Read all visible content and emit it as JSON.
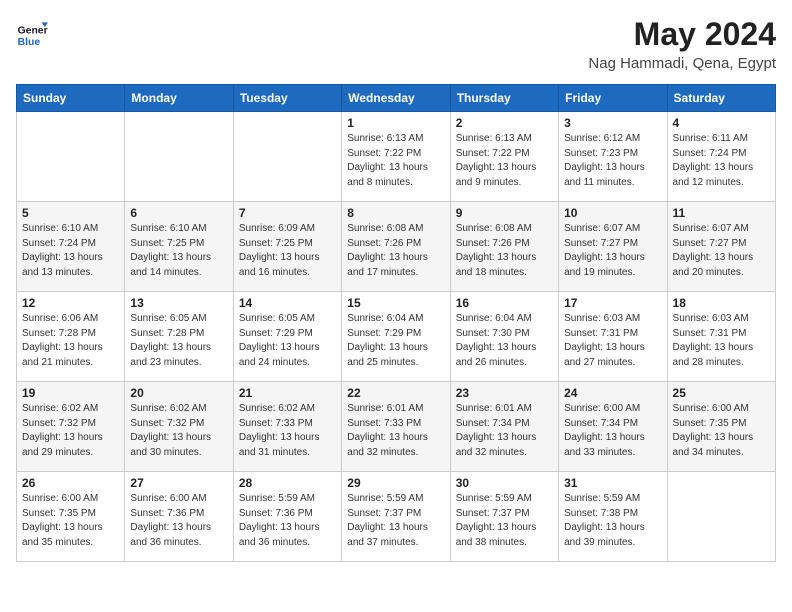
{
  "header": {
    "logo_line1": "General",
    "logo_line2": "Blue",
    "month_title": "May 2024",
    "location": "Nag Hammadi, Qena, Egypt"
  },
  "days_of_week": [
    "Sunday",
    "Monday",
    "Tuesday",
    "Wednesday",
    "Thursday",
    "Friday",
    "Saturday"
  ],
  "weeks": [
    [
      {
        "day": "",
        "sunrise": "",
        "sunset": "",
        "daylight": ""
      },
      {
        "day": "",
        "sunrise": "",
        "sunset": "",
        "daylight": ""
      },
      {
        "day": "",
        "sunrise": "",
        "sunset": "",
        "daylight": ""
      },
      {
        "day": "1",
        "sunrise": "6:13 AM",
        "sunset": "7:22 PM",
        "daylight": "13 hours and 8 minutes."
      },
      {
        "day": "2",
        "sunrise": "6:13 AM",
        "sunset": "7:22 PM",
        "daylight": "13 hours and 9 minutes."
      },
      {
        "day": "3",
        "sunrise": "6:12 AM",
        "sunset": "7:23 PM",
        "daylight": "13 hours and 11 minutes."
      },
      {
        "day": "4",
        "sunrise": "6:11 AM",
        "sunset": "7:24 PM",
        "daylight": "13 hours and 12 minutes."
      }
    ],
    [
      {
        "day": "5",
        "sunrise": "6:10 AM",
        "sunset": "7:24 PM",
        "daylight": "13 hours and 13 minutes."
      },
      {
        "day": "6",
        "sunrise": "6:10 AM",
        "sunset": "7:25 PM",
        "daylight": "13 hours and 14 minutes."
      },
      {
        "day": "7",
        "sunrise": "6:09 AM",
        "sunset": "7:25 PM",
        "daylight": "13 hours and 16 minutes."
      },
      {
        "day": "8",
        "sunrise": "6:08 AM",
        "sunset": "7:26 PM",
        "daylight": "13 hours and 17 minutes."
      },
      {
        "day": "9",
        "sunrise": "6:08 AM",
        "sunset": "7:26 PM",
        "daylight": "13 hours and 18 minutes."
      },
      {
        "day": "10",
        "sunrise": "6:07 AM",
        "sunset": "7:27 PM",
        "daylight": "13 hours and 19 minutes."
      },
      {
        "day": "11",
        "sunrise": "6:07 AM",
        "sunset": "7:27 PM",
        "daylight": "13 hours and 20 minutes."
      }
    ],
    [
      {
        "day": "12",
        "sunrise": "6:06 AM",
        "sunset": "7:28 PM",
        "daylight": "13 hours and 21 minutes."
      },
      {
        "day": "13",
        "sunrise": "6:05 AM",
        "sunset": "7:28 PM",
        "daylight": "13 hours and 23 minutes."
      },
      {
        "day": "14",
        "sunrise": "6:05 AM",
        "sunset": "7:29 PM",
        "daylight": "13 hours and 24 minutes."
      },
      {
        "day": "15",
        "sunrise": "6:04 AM",
        "sunset": "7:29 PM",
        "daylight": "13 hours and 25 minutes."
      },
      {
        "day": "16",
        "sunrise": "6:04 AM",
        "sunset": "7:30 PM",
        "daylight": "13 hours and 26 minutes."
      },
      {
        "day": "17",
        "sunrise": "6:03 AM",
        "sunset": "7:31 PM",
        "daylight": "13 hours and 27 minutes."
      },
      {
        "day": "18",
        "sunrise": "6:03 AM",
        "sunset": "7:31 PM",
        "daylight": "13 hours and 28 minutes."
      }
    ],
    [
      {
        "day": "19",
        "sunrise": "6:02 AM",
        "sunset": "7:32 PM",
        "daylight": "13 hours and 29 minutes."
      },
      {
        "day": "20",
        "sunrise": "6:02 AM",
        "sunset": "7:32 PM",
        "daylight": "13 hours and 30 minutes."
      },
      {
        "day": "21",
        "sunrise": "6:02 AM",
        "sunset": "7:33 PM",
        "daylight": "13 hours and 31 minutes."
      },
      {
        "day": "22",
        "sunrise": "6:01 AM",
        "sunset": "7:33 PM",
        "daylight": "13 hours and 32 minutes."
      },
      {
        "day": "23",
        "sunrise": "6:01 AM",
        "sunset": "7:34 PM",
        "daylight": "13 hours and 32 minutes."
      },
      {
        "day": "24",
        "sunrise": "6:00 AM",
        "sunset": "7:34 PM",
        "daylight": "13 hours and 33 minutes."
      },
      {
        "day": "25",
        "sunrise": "6:00 AM",
        "sunset": "7:35 PM",
        "daylight": "13 hours and 34 minutes."
      }
    ],
    [
      {
        "day": "26",
        "sunrise": "6:00 AM",
        "sunset": "7:35 PM",
        "daylight": "13 hours and 35 minutes."
      },
      {
        "day": "27",
        "sunrise": "6:00 AM",
        "sunset": "7:36 PM",
        "daylight": "13 hours and 36 minutes."
      },
      {
        "day": "28",
        "sunrise": "5:59 AM",
        "sunset": "7:36 PM",
        "daylight": "13 hours and 36 minutes."
      },
      {
        "day": "29",
        "sunrise": "5:59 AM",
        "sunset": "7:37 PM",
        "daylight": "13 hours and 37 minutes."
      },
      {
        "day": "30",
        "sunrise": "5:59 AM",
        "sunset": "7:37 PM",
        "daylight": "13 hours and 38 minutes."
      },
      {
        "day": "31",
        "sunrise": "5:59 AM",
        "sunset": "7:38 PM",
        "daylight": "13 hours and 39 minutes."
      },
      {
        "day": "",
        "sunrise": "",
        "sunset": "",
        "daylight": ""
      }
    ]
  ]
}
